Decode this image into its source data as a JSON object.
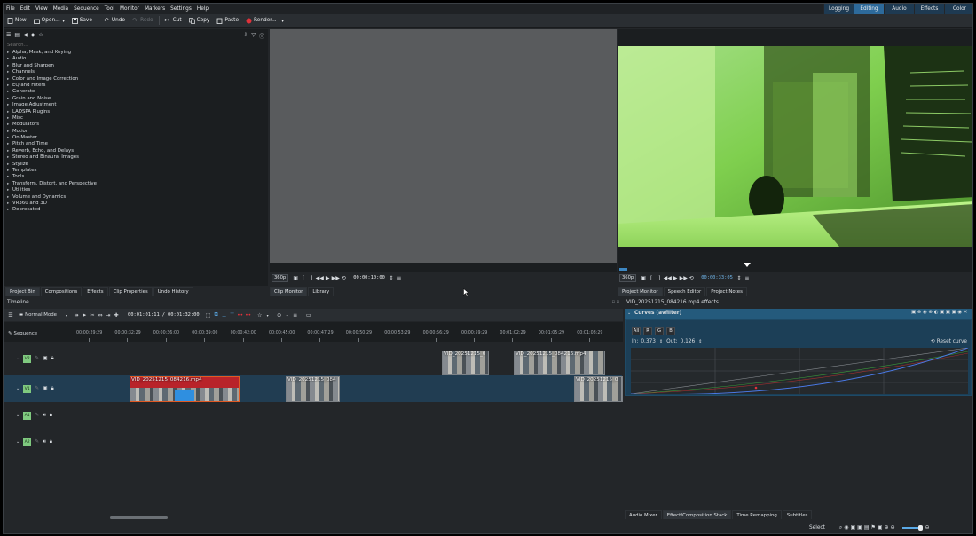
{
  "menu": [
    "File",
    "Edit",
    "View",
    "Media",
    "Sequence",
    "Tool",
    "Monitor",
    "Markers",
    "Settings",
    "Help"
  ],
  "modes": [
    {
      "label": "Logging",
      "on": false
    },
    {
      "label": "Editing",
      "on": true
    },
    {
      "label": "Audio",
      "on": false
    },
    {
      "label": "Effects",
      "on": false
    },
    {
      "label": "Color",
      "on": false
    }
  ],
  "toolbar": {
    "new": "New",
    "open": "Open...",
    "save": "Save",
    "undo": "Undo",
    "redo": "Redo",
    "cut": "Cut",
    "copy": "Copy",
    "paste": "Paste",
    "render": "Render..."
  },
  "effects": {
    "search_placeholder": "Search...",
    "categories": [
      "Alpha, Mask, and Keying",
      "Audio",
      "Blur and Sharpen",
      "Channels",
      "Color and Image Correction",
      "EQ and Filters",
      "Generate",
      "Grain and Noise",
      "Image Adjustment",
      "LADSPA Plugins",
      "Misc",
      "Modulators",
      "Motion",
      "On Master",
      "Pitch and Time",
      "Reverb, Echo, and Delays",
      "Stereo and Binaural Images",
      "Stylize",
      "Templates",
      "Tools",
      "Transform, Distort, and Perspective",
      "Utilities",
      "Volume and Dynamics",
      "VR360 and 3D",
      "Deprecated"
    ]
  },
  "left_tabs": [
    "Project Bin",
    "Compositions",
    "Effects",
    "Clip Properties",
    "Undo History"
  ],
  "clip_monitor": {
    "zoom": "360p",
    "timecode": "00:00:10:00",
    "tabs": [
      "Clip Monitor",
      "Library"
    ]
  },
  "project_monitor": {
    "zoom": "360p",
    "timecode": "00:00:33:05",
    "tabs": [
      "Project Monitor",
      "Speech Editor",
      "Project Notes"
    ]
  },
  "timeline": {
    "title": "Timeline",
    "mode": "Normal Mode",
    "position": "00:01:01:11",
    "duration": "00:01:32:00",
    "sequence": "Sequence",
    "ruler": [
      "00:00:29:29",
      "00:00:32:29",
      "00:00:36:00",
      "00:00:39:00",
      "00:00:42:00",
      "00:00:45:00",
      "00:00:47:29",
      "00:00:50:29",
      "00:00:53:29",
      "00:00:56:29",
      "00:00:59:29",
      "00:01:02:29",
      "00:01:05:29",
      "00:01:08:29"
    ],
    "tracks": [
      {
        "badge": "V2",
        "type": "video"
      },
      {
        "badge": "V1",
        "type": "video"
      },
      {
        "badge": "A1",
        "type": "audio"
      },
      {
        "badge": "A2",
        "type": "audio"
      }
    ],
    "clips": {
      "v2_a": "VID_20251215_0",
      "v2_b": "VID_20251215_084216.mp4",
      "v1_a": "VID_20251215_084216.mp4",
      "v1_b": "VID_20251215_084",
      "v1_c": "VID_20251215_0"
    }
  },
  "effect_stack": {
    "header": "VID_20251215_084216.mp4 effects",
    "effect_name": "Curves (avfilter)",
    "channels": [
      "All",
      "R",
      "G",
      "B"
    ],
    "in_label": "In:",
    "in_value": "0.373",
    "out_label": "Out:",
    "out_value": "0.126",
    "reset": "Reset curve"
  },
  "bottom_tabs": [
    "Audio Mixer",
    "Effect/Composition Stack",
    "Time Remapping",
    "Subtitles"
  ],
  "status": {
    "select": "Select"
  },
  "colors": {
    "accent": "#2d6a9b",
    "selected_clip": "#b8232a",
    "track_badge": "#7fc97f"
  }
}
